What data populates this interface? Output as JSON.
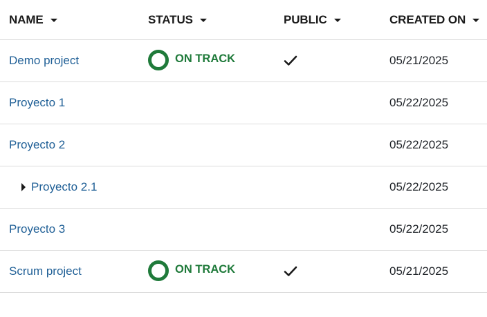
{
  "columns": {
    "name": "NAME",
    "status": "STATUS",
    "public": "PUBLIC",
    "created_on": "CREATED ON"
  },
  "rows": [
    {
      "name": "Demo project",
      "status": "ON TRACK",
      "public": true,
      "created_on": "05/21/2025"
    },
    {
      "name": "Proyecto 1",
      "status": "",
      "public": false,
      "created_on": "05/22/2025"
    },
    {
      "name": "Proyecto 2",
      "status": "",
      "public": false,
      "created_on": "05/22/2025"
    },
    {
      "name": "Proyecto 2.1",
      "status": "",
      "public": false,
      "created_on": "05/22/2025",
      "child": true,
      "collapsed": true
    },
    {
      "name": "Proyecto 3",
      "status": "",
      "public": false,
      "created_on": "05/22/2025"
    },
    {
      "name": "Scrum project",
      "status": "ON TRACK",
      "public": true,
      "created_on": "05/21/2025"
    }
  ],
  "colors": {
    "link": "#1f5f96",
    "status_on_track": "#1f7a3a",
    "divider": "#dcdcdc"
  },
  "icons": {
    "sort": "caret-down-icon",
    "public": "checkmark-icon",
    "status": "status-ring-icon",
    "expand": "expand-triangle-icon"
  }
}
